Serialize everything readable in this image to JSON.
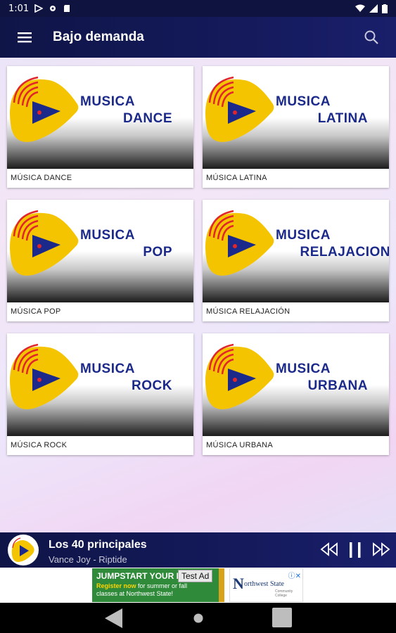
{
  "status_bar": {
    "time": "1:01"
  },
  "app_bar": {
    "title": "Bajo demanda",
    "menu_icon": "hamburger-menu-icon",
    "search_icon": "search-icon"
  },
  "stations": [
    {
      "line1": "MUSICA",
      "line2": "DANCE",
      "caption": "MÚSICA DANCE"
    },
    {
      "line1": "MUSICA",
      "line2": "LATINA",
      "caption": "MÚSICA LATINA"
    },
    {
      "line1": "MUSICA",
      "line2": "POP",
      "caption": "MÚSICA POP"
    },
    {
      "line1": "MUSICA",
      "line2": "RELAJACION",
      "caption": "MÚSICA RELAJACIÓN"
    },
    {
      "line1": "MUSICA",
      "line2": "ROCK",
      "caption": "MÚSICA ROCK"
    },
    {
      "line1": "MUSICA",
      "line2": "URBANA",
      "caption": "MÚSICA URBANA"
    }
  ],
  "player": {
    "track": "Los 40 principales",
    "artist": "Vance Joy - Riptide"
  },
  "ad": {
    "headline": "JUMPSTART YOUR F",
    "body_highlight": "Register now",
    "body_line1": " for summer or fall",
    "body_line2": "classes at Northwest State!",
    "badge": "Test Ad",
    "brand_initial": "N",
    "brand": "orthwest State",
    "brand_sub": "Community College"
  },
  "colors": {
    "app_bar": "#141a5b",
    "logo_yellow": "#f5c400",
    "logo_blue": "#1b2a8a",
    "logo_arcs": "#e0262a"
  }
}
